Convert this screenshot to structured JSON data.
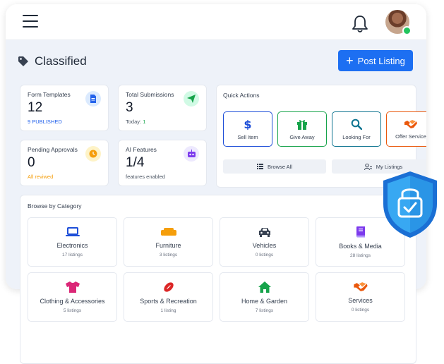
{
  "header": {
    "title": "Classified",
    "post_button_label": "Post Listing"
  },
  "stats": [
    {
      "label": "Form Templates",
      "value": "12",
      "sub": "9 PUBLISHED",
      "sub_color": "#2563eb",
      "icon": "document-icon"
    },
    {
      "label": "Total Submissions",
      "value": "3",
      "sub_prefix": "Today: ",
      "sub_value": "1",
      "icon": "send-icon"
    },
    {
      "label": "Pending Approvals",
      "value": "0",
      "sub": "All reviwed",
      "sub_color": "#f59e0b",
      "icon": "clock-icon"
    },
    {
      "label": "AI Features",
      "value": "1/4",
      "sub": "features enabled",
      "icon": "robot-icon"
    }
  ],
  "quick_actions": {
    "title": "Quick Actions",
    "buttons": [
      {
        "label": "Sell Item",
        "icon": "dollar-icon",
        "color": "#1d4ed8"
      },
      {
        "label": "Give Away",
        "icon": "gift-icon",
        "color": "#16a34a"
      },
      {
        "label": "Looking For",
        "icon": "search-icon",
        "color": "#0e7490"
      },
      {
        "label": "Offer Service",
        "icon": "handshake-icon",
        "color": "#ea580c"
      }
    ],
    "browse_all_label": "Browse All",
    "my_listings_label": "My Listings"
  },
  "categories": {
    "title": "Browse by Category",
    "items": [
      {
        "name": "Electronics",
        "count": "17 listings",
        "icon": "laptop-icon",
        "color": "#1d4ed8"
      },
      {
        "name": "Furniture",
        "count": "3 listings",
        "icon": "sofa-icon",
        "color": "#f59e0b"
      },
      {
        "name": "Vehicles",
        "count": "0 listings",
        "icon": "car-icon",
        "color": "#374151"
      },
      {
        "name": "Books & Media",
        "count": "28 listings",
        "icon": "book-icon",
        "color": "#7c3aed"
      },
      {
        "name": "Clothing & Accessories",
        "count": "5 listings",
        "icon": "shirt-icon",
        "color": "#db2777"
      },
      {
        "name": "Sports & Recreation",
        "count": "1 listing",
        "icon": "football-icon",
        "color": "#dc2626"
      },
      {
        "name": "Home & Garden",
        "count": "7 listings",
        "icon": "house-icon",
        "color": "#16a34a"
      },
      {
        "name": "Services",
        "count": "0 listings",
        "icon": "handshake-icon",
        "color": "#ea580c"
      }
    ]
  },
  "colors": {
    "primary": "#1d6ff2",
    "page_bg": "#eef2f9",
    "online": "#22c55e",
    "shield": "#1e90ff"
  }
}
